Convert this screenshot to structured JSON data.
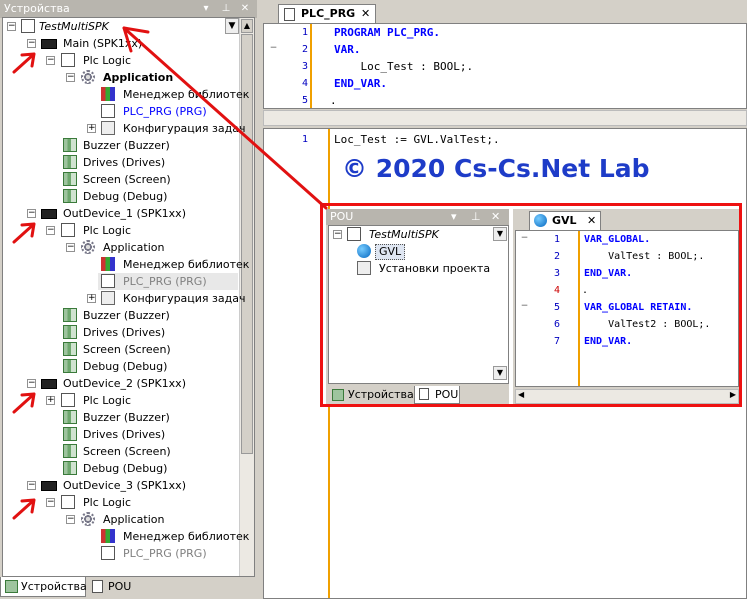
{
  "devices_panel": {
    "title": "Устройства",
    "tabs": [
      "Устройства",
      "POU"
    ],
    "tree": [
      {
        "label": "TestMultiSPK",
        "italic": true
      },
      {
        "label": "Main (SPK1xx)"
      },
      {
        "label": "Plc Logic"
      },
      {
        "label": "Application",
        "bold": true
      },
      {
        "label": "Менеджер библиотек"
      },
      {
        "label": "PLC_PRG (PRG)"
      },
      {
        "label": "Конфигурация задач"
      },
      {
        "label": "Buzzer (Buzzer)"
      },
      {
        "label": "Drives (Drives)"
      },
      {
        "label": "Screen (Screen)"
      },
      {
        "label": "Debug (Debug)"
      },
      {
        "label": "OutDevice_1 (SPK1xx)"
      },
      {
        "label": "Plc Logic"
      },
      {
        "label": "Application"
      },
      {
        "label": "Менеджер библиотек"
      },
      {
        "label": "PLC_PRG (PRG)"
      },
      {
        "label": "Конфигурация задач"
      },
      {
        "label": "Buzzer (Buzzer)"
      },
      {
        "label": "Drives (Drives)"
      },
      {
        "label": "Screen (Screen)"
      },
      {
        "label": "Debug (Debug)"
      },
      {
        "label": "OutDevice_2 (SPK1xx)"
      },
      {
        "label": "Plc Logic"
      },
      {
        "label": "Buzzer (Buzzer)"
      },
      {
        "label": "Drives (Drives)"
      },
      {
        "label": "Screen (Screen)"
      },
      {
        "label": "Debug (Debug)"
      },
      {
        "label": "OutDevice_3 (SPK1xx)"
      },
      {
        "label": "Plc Logic"
      },
      {
        "label": "Application"
      },
      {
        "label": "Менеджер библиотек"
      },
      {
        "label": "PLC_PRG (PRG)"
      }
    ]
  },
  "editor": {
    "tab": "PLC_PRG",
    "decl_lines": [
      "PROGRAM PLC_PRG.",
      "VAR.",
      "    Loc_Test : BOOL;.",
      "END_VAR.",
      "."
    ],
    "decl_numbers": [
      "1",
      "2",
      "3",
      "4",
      "5"
    ],
    "impl_line": "Loc_Test := GVL.ValTest;.",
    "impl_number": "1"
  },
  "watermark": "© 2020 Cs-Cs.Net Lab",
  "pou_panel": {
    "title": "POU",
    "root": "TestMultiSPK",
    "items": [
      "GVL",
      "Установки проекта"
    ],
    "tabs": [
      "Устройства",
      "POU"
    ]
  },
  "gvl_editor": {
    "tab": "GVL",
    "numbers": [
      "1",
      "2",
      "3",
      "4",
      "5",
      "6",
      "7"
    ],
    "lines": [
      "VAR_GLOBAL.",
      "    ValTest : BOOL;.",
      "END_VAR.",
      ".",
      "VAR_GLOBAL RETAIN.",
      "    ValTest2 : BOOL;.",
      "END_VAR."
    ]
  },
  "colors": {
    "annotation": "#e11111",
    "keyword": "#0000ff",
    "watermark": "#1e3cc8"
  }
}
